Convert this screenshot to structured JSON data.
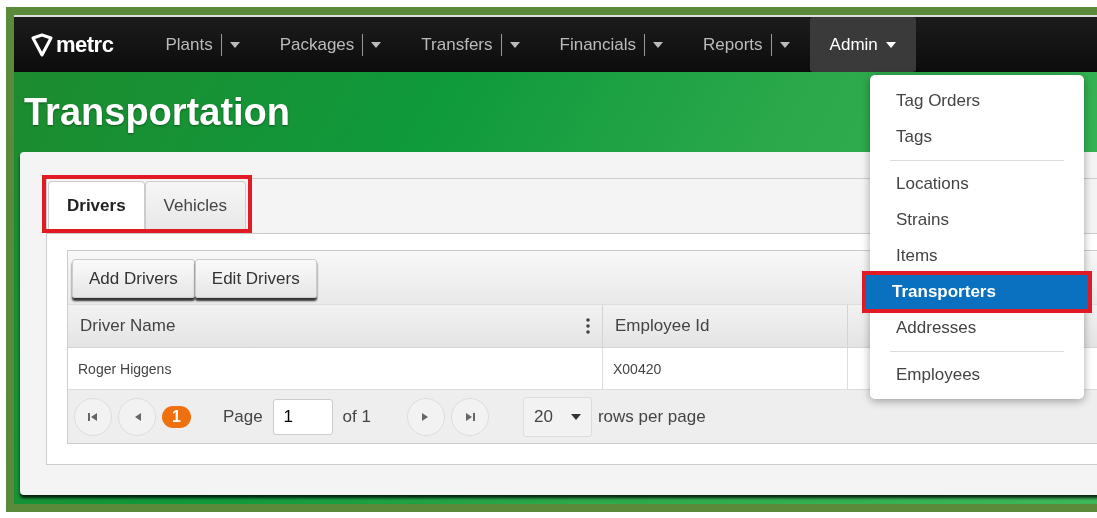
{
  "brand": "metrc",
  "nav": [
    {
      "label": "Plants",
      "split": true,
      "selected": false
    },
    {
      "label": "Packages",
      "split": true,
      "selected": false
    },
    {
      "label": "Transfers",
      "split": true,
      "selected": false
    },
    {
      "label": "Financials",
      "split": true,
      "selected": false
    },
    {
      "label": "Reports",
      "split": true,
      "selected": false
    },
    {
      "label": "Admin",
      "split": false,
      "selected": true
    }
  ],
  "page_title": "Transportation",
  "tabs": [
    {
      "label": "Drivers",
      "selected": true
    },
    {
      "label": "Vehicles",
      "selected": false
    }
  ],
  "tabs_highlighted": true,
  "toolbar": [
    "Add Drivers",
    "Edit Drivers"
  ],
  "table": {
    "columns": [
      "Driver Name",
      "Employee Id"
    ],
    "rows": [
      [
        "Roger Higgens",
        "X00420"
      ]
    ]
  },
  "pager": {
    "current": "1",
    "page_label": "Page",
    "page_value": "1",
    "of_label": "of 1",
    "page_size": "20",
    "rows_label": "rows per page"
  },
  "admin_menu": [
    {
      "label": "Tag Orders",
      "selected": false,
      "highlighted": false,
      "divider_after": false
    },
    {
      "label": "Tags",
      "selected": false,
      "highlighted": false,
      "divider_after": true
    },
    {
      "label": "Locations",
      "selected": false,
      "highlighted": false,
      "divider_after": false
    },
    {
      "label": "Strains",
      "selected": false,
      "highlighted": false,
      "divider_after": false
    },
    {
      "label": "Items",
      "selected": false,
      "highlighted": false,
      "divider_after": false
    },
    {
      "label": "Transporters",
      "selected": true,
      "highlighted": true,
      "divider_after": false
    },
    {
      "label": "Addresses",
      "selected": false,
      "highlighted": false,
      "divider_after": true
    },
    {
      "label": "Employees",
      "selected": false,
      "highlighted": false,
      "divider_after": false
    }
  ]
}
